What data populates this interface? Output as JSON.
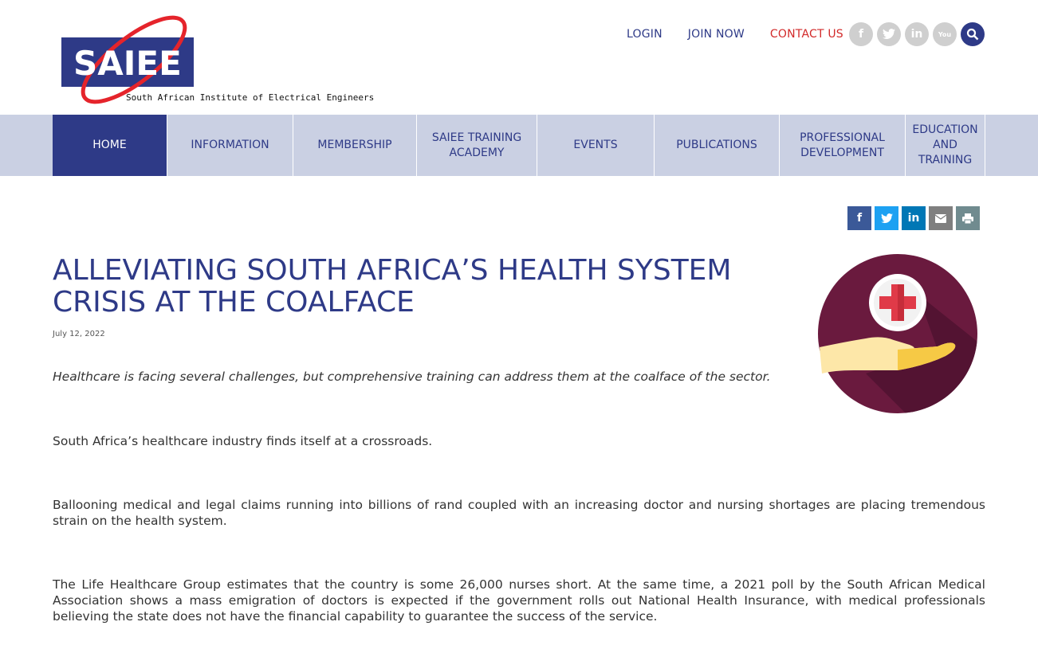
{
  "header": {
    "logo_text": "SAIEE",
    "logo_tagline": "South African Institute of Electrical Engineers",
    "links": {
      "login": "LOGIN",
      "join": "JOIN NOW",
      "contact": "CONTACT US"
    },
    "social_icons": [
      "facebook-icon",
      "twitter-icon",
      "linkedin-icon",
      "youtube-icon",
      "search-icon"
    ]
  },
  "nav": {
    "items": [
      {
        "label": "HOME"
      },
      {
        "label": "INFORMATION"
      },
      {
        "label": "MEMBERSHIP"
      },
      {
        "label": "SAIEE TRAINING ACADEMY"
      },
      {
        "label": "EVENTS"
      },
      {
        "label": "PUBLICATIONS"
      },
      {
        "label": "PROFESSIONAL DEVELOPMENT"
      },
      {
        "label": "EDUCATION AND TRAINING"
      }
    ],
    "active_index": 0
  },
  "share": {
    "icons": [
      "facebook-icon",
      "twitter-icon",
      "linkedin-icon",
      "email-icon",
      "print-icon"
    ],
    "colors": [
      "#3b5998",
      "#1da1f2",
      "#0077b5",
      "#7f7f7f",
      "#708b8f"
    ]
  },
  "article": {
    "title": "ALLEVIATING SOUTH AFRICA’S HEALTH SYSTEM CRISIS AT THE COALFACE",
    "date": "July 12, 2022",
    "lead": "Healthcare is facing several challenges, but comprehensive training can address them at the coalface of the sector.",
    "paragraphs": [
      "South Africa’s healthcare industry finds itself at a crossroads.",
      "Ballooning medical and legal claims running into billions of rand coupled with an increasing doctor and nursing shortages are placing tremendous strain on the health system.",
      "The Life Healthcare Group estimates that the country is some 26,000 nurses short. At the same time, a 2021 poll by the South African Medical Association shows a mass emigration of doctors is expected if the government rolls out National Health Insurance, with medical professionals believing the state does not have the financial capability to guarantee the success of the service."
    ]
  },
  "colors": {
    "brand": "#2e3a87",
    "nav_bg": "#cad0e3",
    "contact": "#d22a2a",
    "logo_red": "#e5242b"
  }
}
